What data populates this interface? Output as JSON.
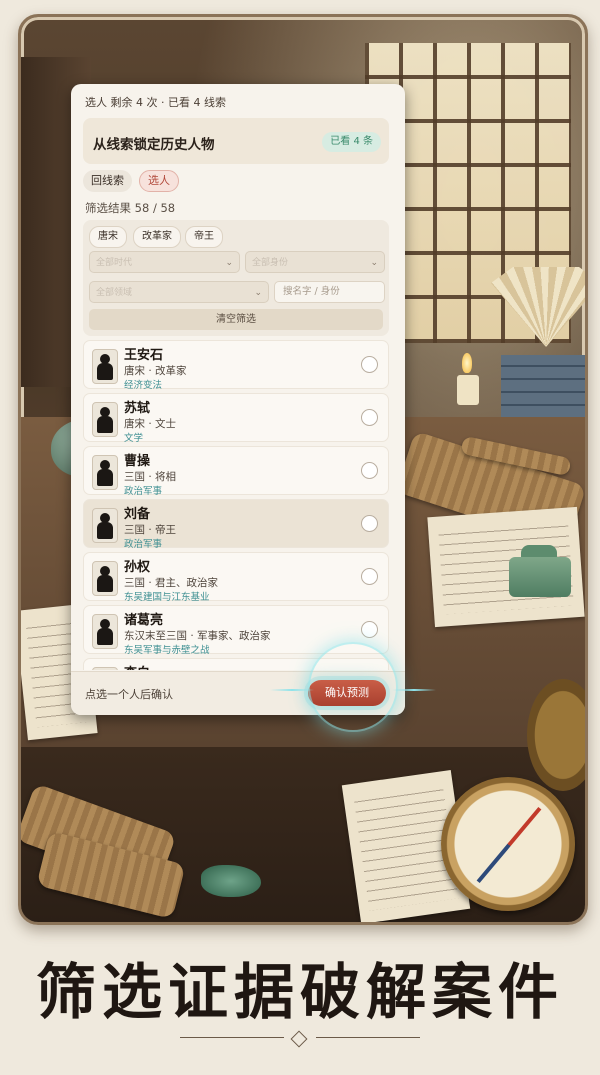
{
  "panel": {
    "status_line": "选人  剩余 4 次 · 已看 4 线索",
    "title": "从线索锁定历史人物",
    "seen_badge": "已看 4 条",
    "tabs": {
      "back": "回线索",
      "pick": "选人"
    },
    "result_text": "筛选结果 58 / 58",
    "filter_chips": [
      "唐宋",
      "改革家",
      "帝王"
    ],
    "selects": [
      {
        "placeholder": "全部时代"
      },
      {
        "placeholder": "全部身份"
      },
      {
        "placeholder": "全部领域"
      }
    ],
    "search_placeholder": "搜名字 / 身份",
    "clear_label": "清空筛选",
    "people": [
      {
        "name": "王安石",
        "meta": "唐宋 · 改革家",
        "tag": "经济变法",
        "selected": false
      },
      {
        "name": "苏轼",
        "meta": "唐宋 · 文士",
        "tag": "文学",
        "selected": false
      },
      {
        "name": "曹操",
        "meta": "三国 · 将相",
        "tag": "政治军事",
        "selected": false
      },
      {
        "name": "刘备",
        "meta": "三国 · 帝王",
        "tag": "政治军事",
        "selected": true
      },
      {
        "name": "孙权",
        "meta": "三国 · 君主、政治家",
        "tag": "东吴建国与江东基业",
        "selected": false
      },
      {
        "name": "诸葛亮",
        "meta": "东汉末至三国 · 军事家、政治家",
        "tag": "东吴军事与赤壁之战",
        "selected": false
      },
      {
        "name": "李白",
        "meta": "",
        "tag": "",
        "selected": false
      }
    ],
    "footer_hint": "点选一个人后确认",
    "confirm_label": "确认预测"
  },
  "slogan": "筛选证据破解案件",
  "colors": {
    "accent_red": "#b24a3c",
    "teal_tag": "#3e8f92",
    "badge_green": "#3a8a6b"
  }
}
